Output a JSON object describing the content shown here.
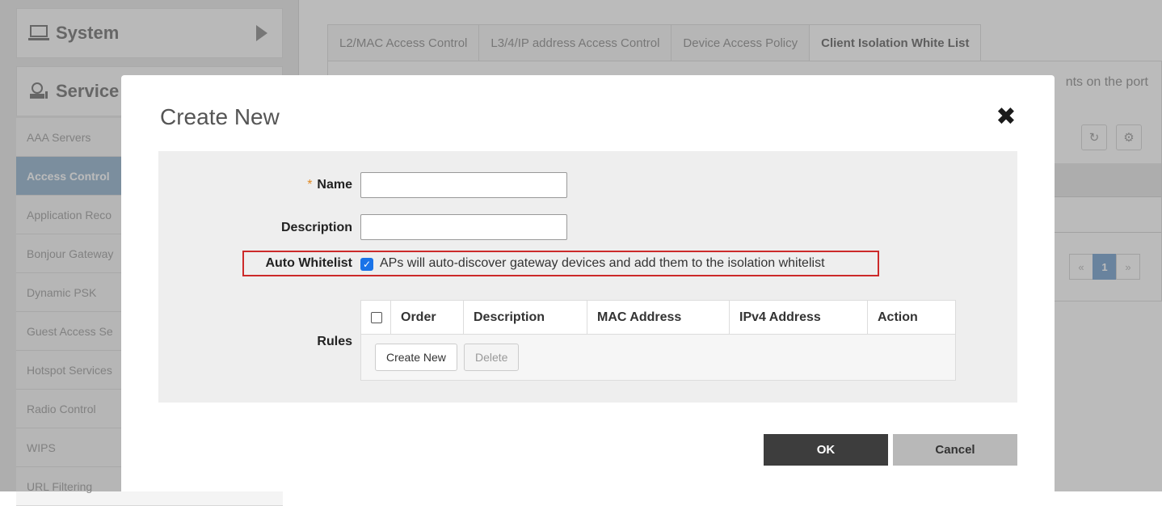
{
  "sidebar": {
    "system_label": "System",
    "services_label": "Service",
    "items": [
      {
        "label": "AAA Servers"
      },
      {
        "label": "Access Control"
      },
      {
        "label": "Application Reco"
      },
      {
        "label": "Bonjour Gateway"
      },
      {
        "label": "Dynamic PSK"
      },
      {
        "label": "Guest Access Se"
      },
      {
        "label": "Hotspot Services"
      },
      {
        "label": "Radio Control"
      },
      {
        "label": "WIPS"
      },
      {
        "label": "URL Filtering"
      }
    ]
  },
  "tabs": [
    {
      "label": "L2/MAC Access Control"
    },
    {
      "label": "L3/4/IP address Access Control"
    },
    {
      "label": "Device Access Policy"
    },
    {
      "label": "Client Isolation White List"
    }
  ],
  "background": {
    "partial_text": "nts on the port",
    "pager_prev": "«",
    "pager_page": "1",
    "pager_next": "»"
  },
  "modal": {
    "title": "Create New",
    "name_required_mark": "*",
    "name_label": "Name",
    "name_value": "",
    "description_label": "Description",
    "description_value": "",
    "auto_whitelist_label": "Auto Whitelist",
    "auto_whitelist_checked": true,
    "auto_whitelist_text": "APs will auto-discover gateway devices and add them to the isolation whitelist",
    "rules_label": "Rules",
    "rules_columns": [
      "Order",
      "Description",
      "MAC Address",
      "IPv4 Address",
      "Action"
    ],
    "rules_create_button": "Create New",
    "rules_delete_button": "Delete",
    "ok_button": "OK",
    "cancel_button": "Cancel"
  },
  "colors": {
    "accent_blue": "#1a73e8",
    "highlight_red": "#cc2a2a",
    "required_orange": "#e08a25",
    "ok_dark": "#3d3d3d"
  }
}
